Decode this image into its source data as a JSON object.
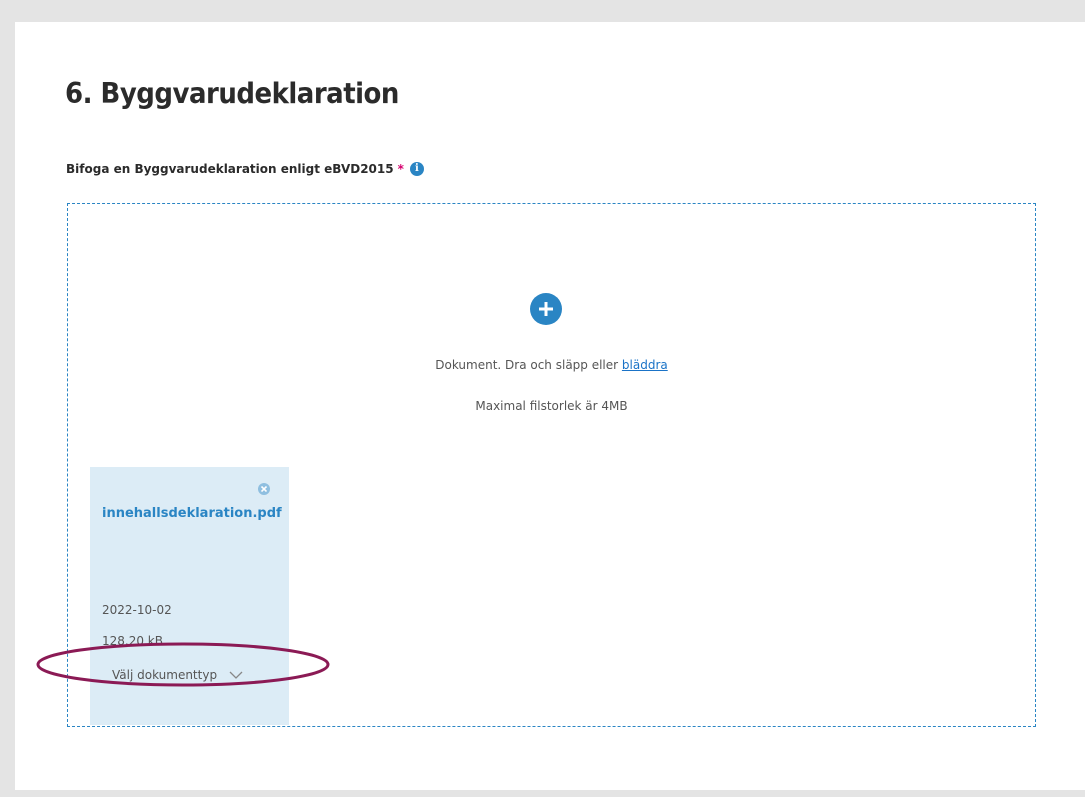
{
  "section": {
    "title": "6. Byggvarudeklaration"
  },
  "field": {
    "label": "Bifoga en Byggvarudeklaration enligt eBVD2015",
    "required_marker": "*",
    "info_icon": "info-icon"
  },
  "dropzone": {
    "add_icon": "plus-circle-icon",
    "instruction_prefix": "Dokument. Dra och släpp eller ",
    "browse_link": "bläddra",
    "max_size_text": "Maximal filstorlek är 4MB"
  },
  "file": {
    "name": "innehallsdeklaration.pdf",
    "date": "2022-10-02",
    "size": "128.20 kB",
    "doc_type_placeholder": "Välj dokumenttyp",
    "remove_icon": "close-circle-icon"
  },
  "colors": {
    "accent": "#2a85c4",
    "required": "#d6006e",
    "file_card_bg": "#dcecf6",
    "annotation": "#8b1a55"
  }
}
